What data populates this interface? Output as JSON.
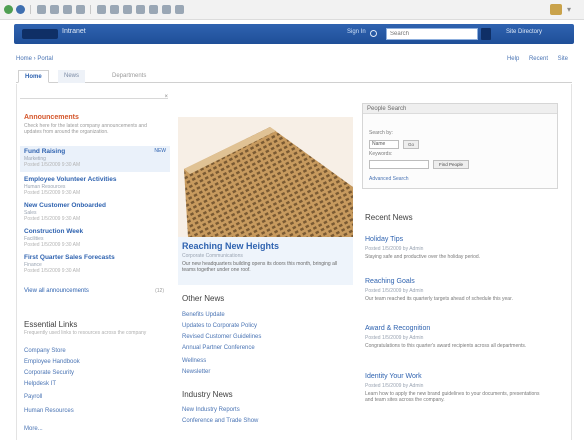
{
  "colors": {
    "header_blue": "#2f63b0",
    "link_blue": "#2f63b0",
    "announcement_orange": "#d4552a",
    "selected_row": "#eaf1fa"
  },
  "header": {
    "logo_text": "Intranet",
    "signin": "Sign In",
    "search_placeholder": "Search",
    "right_link": "Site Directory"
  },
  "breadcrumb": "Home › Portal",
  "subnav": [
    "Help",
    "Recent",
    "Site"
  ],
  "tabs": [
    "Home",
    "News",
    "Departments"
  ],
  "announcements": {
    "title": "Announcements",
    "body": "Check here for the latest company announcements and updates from around the organization.",
    "items": [
      {
        "title": "Fund Raising",
        "meta": "Marketing",
        "sub": "Posted 1/5/2009 9:30 AM",
        "badge": "NEW"
      },
      {
        "title": "Employee Volunteer Activities",
        "meta": "Human Resources",
        "sub": "Posted 1/5/2009 9:30 AM",
        "badge": ""
      },
      {
        "title": "New Customer Onboarded",
        "meta": "Sales",
        "sub": "Posted 1/5/2009 9:30 AM",
        "badge": ""
      },
      {
        "title": "Construction Week",
        "meta": "Facilities",
        "sub": "Posted 1/5/2009 9:30 AM",
        "badge": ""
      },
      {
        "title": "First Quarter Sales Forecasts",
        "meta": "Finance",
        "sub": "Posted 1/5/2009 9:30 AM",
        "badge": ""
      }
    ],
    "all_link": "View all announcements",
    "all_count": "(12)"
  },
  "essential_links": {
    "title": "Essential Links",
    "desc": "Frequently used links to resources across the company",
    "items": [
      "Company Store",
      "Employee Handbook",
      "Corporate Security",
      "Helpdesk IT",
      "Payroll",
      "Human Resources",
      "More..."
    ]
  },
  "feature": {
    "title": "Reaching New Heights",
    "meta": "Corporate Communications",
    "desc": "Our new headquarters building opens its doors this month, bringing all teams together under one roof."
  },
  "other_news": {
    "title": "Other News",
    "items": [
      "Benefits Update",
      "Updates to Corporate Policy",
      "Revised Customer Guidelines",
      "Annual Partner Conference",
      "Wellness",
      "Newsletter"
    ]
  },
  "industry_news": {
    "title": "Industry News",
    "items": [
      "New Industry Reports",
      "Conference and Trade Show"
    ]
  },
  "quick": {
    "title": "People Search",
    "label1": "Search by:",
    "select_value": "Name",
    "go_label": "Go",
    "label2": "Keywords:",
    "button_label": "Find People",
    "advanced": "Advanced Search"
  },
  "recent_news": {
    "title": "Recent News",
    "items": [
      {
        "title": "Holiday Tips",
        "meta": "Posted 1/5/2009 by Admin",
        "desc": "Staying safe and productive over the holiday period."
      },
      {
        "title": "Reaching Goals",
        "meta": "Posted 1/5/2009 by Admin",
        "desc": "Our team reached its quarterly targets ahead of schedule this year."
      },
      {
        "title": "Award & Recognition",
        "meta": "Posted 1/5/2009 by Admin",
        "desc": "Congratulations to this quarter's award recipients across all departments."
      },
      {
        "title": "Identity Your Work",
        "meta": "Posted 1/5/2009 by Admin",
        "desc": "Learn how to apply the new brand guidelines to your documents, presentations and team sites across the company."
      }
    ]
  }
}
